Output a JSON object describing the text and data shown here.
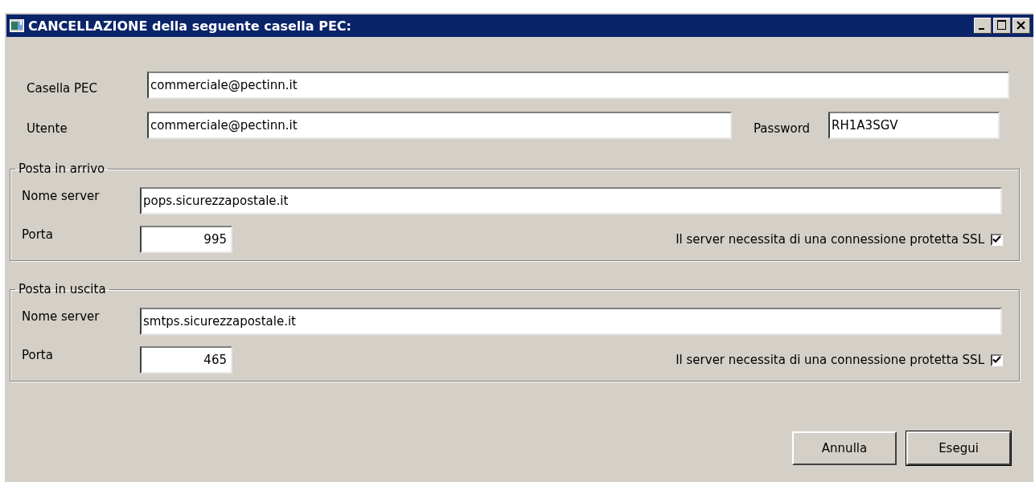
{
  "window": {
    "title": "CANCELLAZIONE della seguente casella PEC:"
  },
  "account": {
    "mailbox": {
      "label": "Casella PEC",
      "value": "commerciale@pectinn.it"
    },
    "user": {
      "label": "Utente",
      "value": "commerciale@pectinn.it"
    },
    "password": {
      "label": "Password",
      "value": "RH1A3SGV"
    }
  },
  "groups": [
    {
      "title": "Posta in arrivo",
      "server": {
        "label": "Nome server",
        "value": "pops.sicurezzapostale.it"
      },
      "port": {
        "label": "Porta",
        "value": "995"
      },
      "ssl": {
        "label": "Il server necessita di una connessione protetta SSL",
        "checked": true
      }
    },
    {
      "title": "Posta in uscita",
      "server": {
        "label": "Nome server",
        "value": "smtps.sicurezzapostale.it"
      },
      "port": {
        "label": "Porta",
        "value": "465"
      },
      "ssl": {
        "label": "Il server necessita di una connessione protetta SSL",
        "checked": true
      }
    }
  ],
  "buttons": [
    {
      "label": "Annulla",
      "default": false
    },
    {
      "label": "Esegui",
      "default": true
    }
  ]
}
